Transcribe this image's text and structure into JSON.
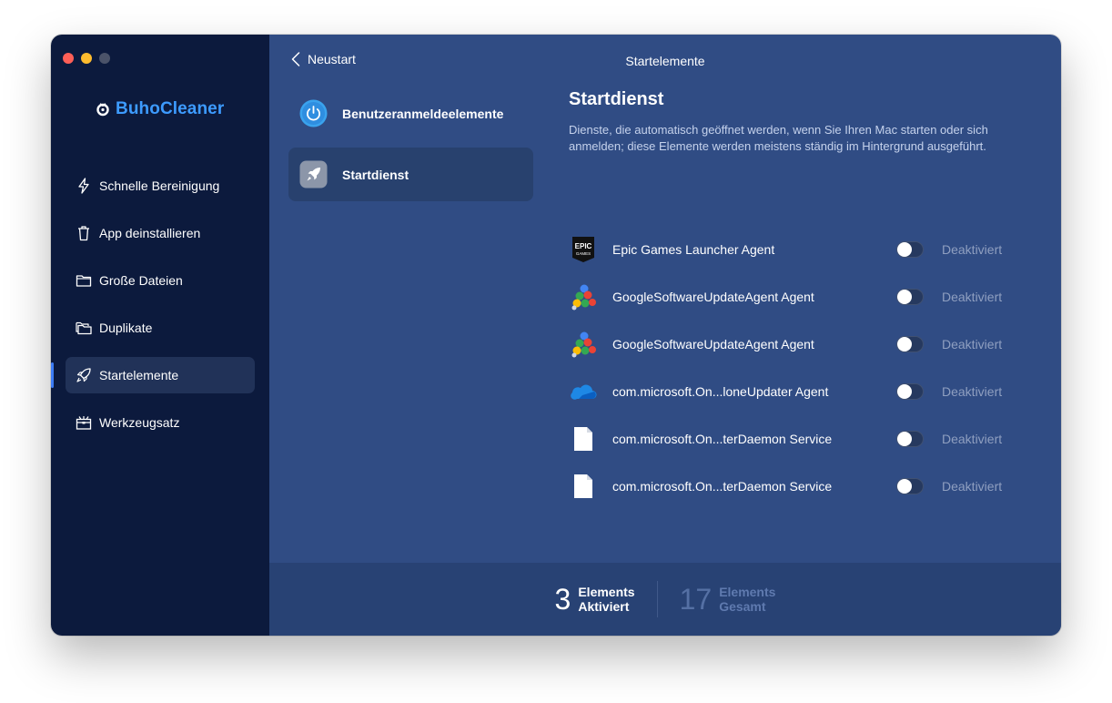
{
  "app": {
    "name": "BuhoCleaner"
  },
  "sidebar": {
    "items": [
      {
        "label": "Schnelle Bereinigung",
        "icon": "lightning-icon",
        "active": false
      },
      {
        "label": "App deinstallieren",
        "icon": "trash-icon",
        "active": false
      },
      {
        "label": "Große Dateien",
        "icon": "folder-icon",
        "active": false
      },
      {
        "label": "Duplikate",
        "icon": "duplicate-folder-icon",
        "active": false
      },
      {
        "label": "Startelemente",
        "icon": "rocket-icon",
        "active": true
      },
      {
        "label": "Werkzeugsatz",
        "icon": "toolbox-icon",
        "active": false
      }
    ]
  },
  "header": {
    "back_label": "Neustart",
    "title": "Startelemente"
  },
  "categories": [
    {
      "label": "Benutzeranmeldeelemente",
      "icon": "power-icon",
      "active": false
    },
    {
      "label": "Startdienst",
      "icon": "rocket-icon",
      "active": true
    }
  ],
  "detail": {
    "title": "Startdienst",
    "description": "Dienste, die automatisch geöffnet werden, wenn Sie Ihren Mac starten oder sich anmelden; diese Elemente werden meistens ständig im Hintergrund ausgeführt."
  },
  "items": [
    {
      "name": "Epic Games Launcher Agent",
      "icon": "epic-games-icon",
      "status": "Deaktiviert",
      "enabled": false
    },
    {
      "name": "GoogleSoftwareUpdateAgent Agent",
      "icon": "google-update-icon",
      "status": "Deaktiviert",
      "enabled": false
    },
    {
      "name": "GoogleSoftwareUpdateAgent Agent",
      "icon": "google-update-icon",
      "status": "Deaktiviert",
      "enabled": false
    },
    {
      "name": "com.microsoft.On...loneUpdater Agent",
      "icon": "onedrive-cloud-icon",
      "status": "Deaktiviert",
      "enabled": false
    },
    {
      "name": "com.microsoft.On...terDaemon Service",
      "icon": "document-icon",
      "status": "Deaktiviert",
      "enabled": false
    },
    {
      "name": "com.microsoft.On...terDaemon Service",
      "icon": "document-icon",
      "status": "Deaktiviert",
      "enabled": false
    }
  ],
  "footer": {
    "activated": {
      "count": "3",
      "line1": "Elements",
      "line2": "Aktiviert"
    },
    "total": {
      "count": "17",
      "line1": "Elements",
      "line2": "Gesamt"
    }
  },
  "colors": {
    "sidebar_bg": "#0c1a3d",
    "main_bg": "#304c84",
    "accent": "#3d9bff",
    "footer_bg": "#284274"
  }
}
